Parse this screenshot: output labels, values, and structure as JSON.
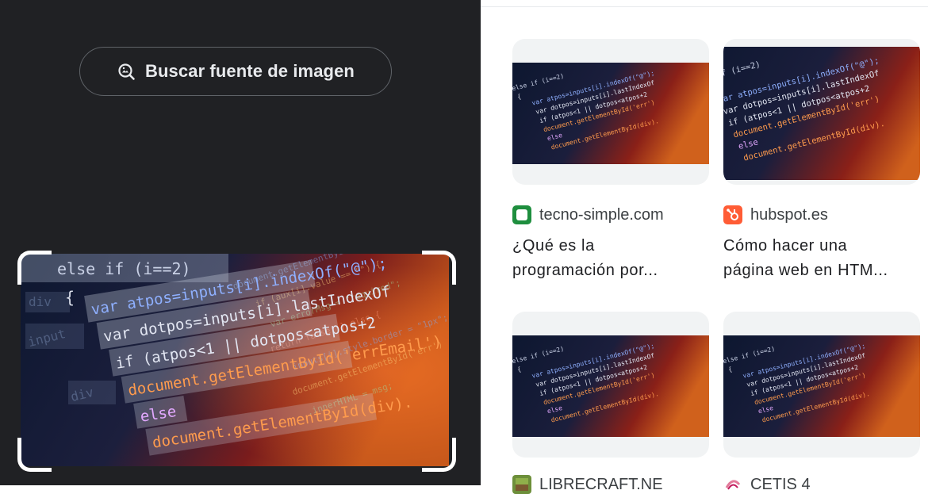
{
  "search_source_button": {
    "label": "Buscar fuente de imagen",
    "icon": "image-search-icon"
  },
  "results": [
    {
      "site": "tecno-simple.com",
      "title_line1": "¿Qué es la",
      "title_line2": "programación por...",
      "favicon_icon": "tecno-simple-favicon-icon",
      "favicon_color": "#1e8e3e"
    },
    {
      "site": "hubspot.es",
      "title_line1": "Cómo hacer una",
      "title_line2": "página web en HTM...",
      "favicon_icon": "hubspot-favicon-icon",
      "favicon_color": "#ff5c35"
    },
    {
      "site": "LIBRECRAFT.NE",
      "favicon_icon": "librecraft-favicon-icon"
    },
    {
      "site": "CETIS 4",
      "favicon_icon": "cetis-favicon-icon"
    }
  ],
  "main_image": {
    "code_lines": [
      "else if (i==2)",
      "{",
      "var atpos=inputs[i].indexOf(\"@\");",
      "var dotpos=inputs[i].lastIndexOf",
      "if (atpos<1 || dotpos<atpos+2",
      "document.getElementById('errEmail')",
      "else",
      "document.getElementById(div)."
    ],
    "bg_words": [
      "div",
      "input",
      "div"
    ]
  },
  "colors": {
    "panel_bg": "#202124",
    "panel_text": "#e8eaed",
    "card_bg": "#f1f3f4",
    "accent_orange": "#e8710a"
  }
}
